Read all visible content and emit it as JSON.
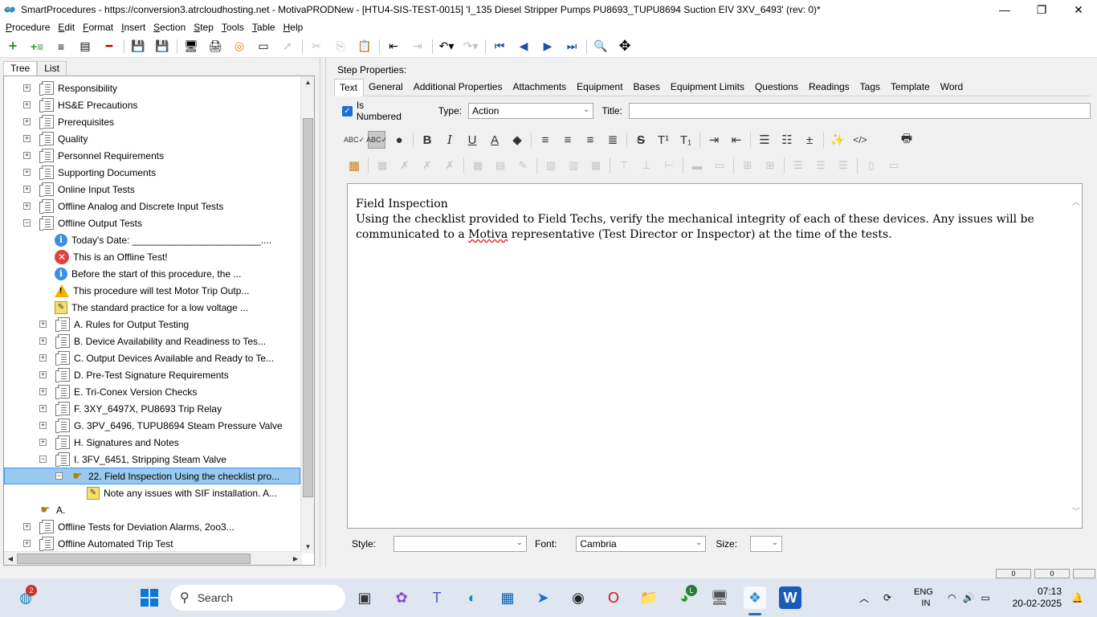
{
  "window": {
    "title": "SmartProcedures - https://conversion3.atrcloudhosting.net - MotivaPRODNew - [HTU4-SIS-TEST-0015] 'I_135 Diesel Stripper Pumps PU8693_TUPU8694 Suction EIV 3XV_6493' (rev: 0)*"
  },
  "menu": [
    {
      "label": "Procedure",
      "u": "P",
      "rest": "rocedure"
    },
    {
      "label": "Edit",
      "u": "E",
      "rest": "dit"
    },
    {
      "label": "Format",
      "u": "F",
      "rest": "ormat"
    },
    {
      "label": "Insert",
      "u": "I",
      "rest": "nsert"
    },
    {
      "label": "Section",
      "u": "S",
      "rest": "ection"
    },
    {
      "label": "Step",
      "u": "S",
      "rest": "tep"
    },
    {
      "label": "Tools",
      "u": "T",
      "rest": "ools"
    },
    {
      "label": "Table",
      "u": "T",
      "rest": "able"
    },
    {
      "label": "Help",
      "u": "H",
      "rest": "elp"
    }
  ],
  "left_tabs": [
    "Tree",
    "List"
  ],
  "tree": [
    {
      "label": "Responsibility",
      "icon": "doc",
      "exp": "+",
      "level": 0
    },
    {
      "label": "HS&E Precautions",
      "icon": "doc",
      "exp": "+",
      "level": 0
    },
    {
      "label": "Prerequisites",
      "icon": "doc",
      "exp": "+",
      "level": 0
    },
    {
      "label": "Quality",
      "icon": "doc",
      "exp": "+",
      "level": 0
    },
    {
      "label": "Personnel Requirements",
      "icon": "doc",
      "exp": "+",
      "level": 0
    },
    {
      "label": "Supporting Documents",
      "icon": "doc",
      "exp": "+",
      "level": 0
    },
    {
      "label": "Online Input Tests",
      "icon": "doc",
      "exp": "+",
      "level": 0
    },
    {
      "label": "Offline Analog and Discrete Input Tests",
      "icon": "doc",
      "exp": "+",
      "level": 0
    },
    {
      "label": "Offline Output Tests",
      "icon": "doc",
      "exp": "−",
      "level": 0
    },
    {
      "label": "Today's Date: ________________________....",
      "icon": "info",
      "exp": "",
      "level": 1
    },
    {
      "label": "This is an Offline Test!",
      "icon": "error",
      "exp": "",
      "level": 1
    },
    {
      "label": "Before the start of this procedure, the ...",
      "icon": "info",
      "exp": "",
      "level": 1
    },
    {
      "label": "This procedure will test Motor Trip Outp...",
      "icon": "warn",
      "exp": "",
      "level": 1
    },
    {
      "label": "The standard practice for a low voltage ...",
      "icon": "note",
      "exp": "",
      "level": 1
    },
    {
      "label": "A. Rules for Output Testing",
      "icon": "doc",
      "exp": "+",
      "level": 1
    },
    {
      "label": "B. Device Availability and Readiness to Tes...",
      "icon": "doc",
      "exp": "+",
      "level": 1
    },
    {
      "label": "C. Output Devices Available and Ready to Te...",
      "icon": "doc",
      "exp": "+",
      "level": 1
    },
    {
      "label": "D. Pre-Test Signature Requirements",
      "icon": "doc",
      "exp": "+",
      "level": 1
    },
    {
      "label": "E. Tri-Conex Version Checks",
      "icon": "doc",
      "exp": "+",
      "level": 1
    },
    {
      "label": "F. 3XY_6497X, PU8693 Trip Relay",
      "icon": "doc",
      "exp": "+",
      "level": 1
    },
    {
      "label": "G. 3PV_6496, TUPU8694 Steam Pressure Valve",
      "icon": "doc",
      "exp": "+",
      "level": 1
    },
    {
      "label": "H. Signatures and Notes",
      "icon": "doc",
      "exp": "+",
      "level": 1
    },
    {
      "label": "I. 3FV_6451, Stripping Steam Valve",
      "icon": "doc",
      "exp": "−",
      "level": 1
    },
    {
      "label": "22. Field Inspection Using the checklist pro...",
      "icon": "hand",
      "exp": "−",
      "level": 2,
      "selected": true
    },
    {
      "label": "Note any issues with SIF installation. A...",
      "icon": "note",
      "exp": "",
      "level": 3
    },
    {
      "label": "A.",
      "icon": "hand",
      "exp": "",
      "level": 0,
      "noexp": true
    },
    {
      "label": "Offline Tests for Deviation Alarms, 2oo3...",
      "icon": "doc",
      "exp": "+",
      "level": 0
    },
    {
      "label": "Offline Automated Trip Test",
      "icon": "doc",
      "exp": "+",
      "level": 0
    }
  ],
  "step_props": {
    "label": "Step Properties:",
    "tabs": [
      "Text",
      "General",
      "Additional Properties",
      "Attachments",
      "Equipment",
      "Bases",
      "Equipment Limits",
      "Questions",
      "Readings",
      "Tags",
      "Template",
      "Word"
    ],
    "is_numbered_label": "Is Numbered",
    "type_label": "Type:",
    "type_value": "Action",
    "title_label": "Title:",
    "title_value": ""
  },
  "editor": {
    "heading": "Field Inspection",
    "body_before": "Using the checklist provided to Field Techs, verify the mechanical integrity of each of these devices. Any issues will be communicated to a ",
    "body_squiggle": "Motiva",
    "body_after": " representative (Test Director or Inspector) at the time of the tests."
  },
  "bottom": {
    "style_label": "Style:",
    "style_value": "",
    "font_label": "Font:",
    "font_value": "Cambria",
    "size_label": "Size:",
    "size_value": ""
  },
  "status_panels": [
    "0",
    "0"
  ],
  "taskbar": {
    "search_label": "Search",
    "badge": "2",
    "chrome_badge": "L",
    "lang": "ENG",
    "region": "IN",
    "time": "07:13",
    "date": "20-02-2025"
  }
}
